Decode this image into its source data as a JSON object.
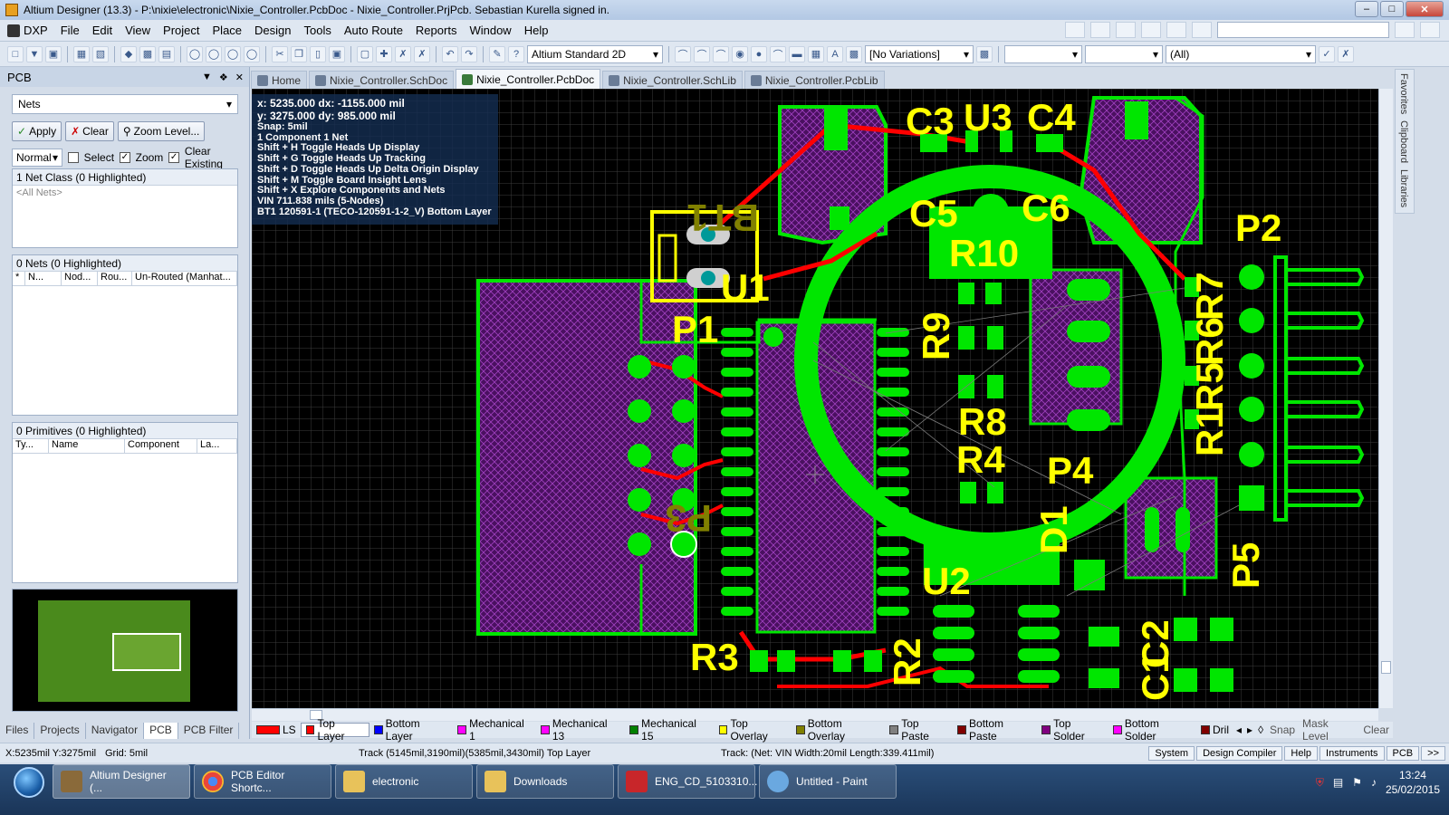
{
  "window": {
    "title": "Altium Designer (13.3) - P:\\nixie\\electronic\\Nixie_Controller.PcbDoc - Nixie_Controller.PrjPcb. Sebastian Kurella signed in."
  },
  "menu": {
    "items": [
      "DXP",
      "File",
      "Edit",
      "View",
      "Project",
      "Place",
      "Design",
      "Tools",
      "Auto Route",
      "Reports",
      "Window",
      "Help"
    ]
  },
  "toolbar": {
    "view_mode": "Altium Standard 2D",
    "variations": "[No Variations]",
    "filter_all": "(All)"
  },
  "panel": {
    "title": "PCB",
    "mode": "Nets",
    "apply": "Apply",
    "clear": "Clear",
    "zoom_level": "Zoom Level...",
    "mask_mode": "Normal",
    "select": "Select",
    "zoom": "Zoom",
    "clear_existing": "Clear Existing",
    "net_class_header": "1 Net Class (0 Highlighted)",
    "all_nets": "<All Nets>",
    "nets_header": "0 Nets (0 Highlighted)",
    "net_cols": [
      "*",
      "N...",
      "Nod...",
      "Rou...",
      "Un-Routed (Manhat..."
    ],
    "primitives_header": "0 Primitives (0 Highlighted)",
    "prim_cols": [
      "Ty...",
      "Name",
      "Component",
      "La..."
    ],
    "tabs": [
      "Files",
      "Projects",
      "Navigator",
      "PCB",
      "PCB Filter"
    ]
  },
  "doc_tabs": [
    "Home",
    "Nixie_Controller.SchDoc",
    "Nixie_Controller.PcbDoc",
    "Nixie_Controller.SchLib",
    "Nixie_Controller.PcbLib"
  ],
  "right_sidebar": [
    "Favorites",
    "Clipboard",
    "Libraries"
  ],
  "hud": {
    "line1": "x:  5235.000   dx: -1155.000  mil",
    "line2": "y:  3275.000   dy:  985.000  mil",
    "lines": [
      "Snap: 5mil",
      "1 Component 1 Net",
      "Shift + H   Toggle Heads Up Display",
      "Shift + G   Toggle Heads Up Tracking",
      "Shift + D   Toggle Heads Up Delta Origin Display",
      "Shift + M   Toggle Board Insight Lens",
      "Shift + X   Explore Components and Nets",
      "VIN    711.838 mils  (5-Nodes)",
      "BT1  120591-1 (TECO-120591-1-2_V)  Bottom Layer"
    ]
  },
  "designators": [
    "C3",
    "U3",
    "C4",
    "C5",
    "C6",
    "R10",
    "BT1",
    "U1",
    "P1",
    "P2",
    "R7",
    "R6",
    "R5",
    "R1",
    "R9",
    "R8",
    "R4",
    "P4",
    "D1",
    "P5",
    "P3",
    "U2",
    "R3",
    "R2",
    "C2",
    "C1"
  ],
  "layers": {
    "ls": "LS",
    "items": [
      {
        "name": "Top Layer",
        "color": "#ff0000"
      },
      {
        "name": "Bottom Layer",
        "color": "#0000ff"
      },
      {
        "name": "Mechanical 1",
        "color": "#ff00ff"
      },
      {
        "name": "Mechanical 13",
        "color": "#ff00ff"
      },
      {
        "name": "Mechanical 15",
        "color": "#008000"
      },
      {
        "name": "Top Overlay",
        "color": "#ffff00"
      },
      {
        "name": "Bottom Overlay",
        "color": "#808000"
      },
      {
        "name": "Top Paste",
        "color": "#808080"
      },
      {
        "name": "Bottom Paste",
        "color": "#800000"
      },
      {
        "name": "Top Solder",
        "color": "#800080"
      },
      {
        "name": "Bottom Solder",
        "color": "#ff00ff"
      },
      {
        "name": "Dril",
        "color": "#800000"
      }
    ],
    "snap": "Snap",
    "mask_level": "Mask Level",
    "clear": "Clear"
  },
  "status": {
    "coords": "X:5235mil Y:3275mil",
    "grid": "Grid: 5mil",
    "track": "Track (5145mil,3190mil)(5385mil,3430mil)  Top Layer",
    "net": "Track: (Net: VIN Width:20mil Length:339.411mil)",
    "buttons": [
      "System",
      "Design Compiler",
      "Help",
      "Instruments",
      "PCB",
      ">>"
    ]
  },
  "taskbar": {
    "items": [
      "Altium Designer (...",
      "PCB Editor Shortc...",
      "electronic",
      "Downloads",
      "ENG_CD_5103310...",
      "Untitled - Paint"
    ],
    "time": "13:24",
    "date": "25/02/2015"
  },
  "colors": {
    "copper": "#00e600",
    "top_layer": "#ff0000",
    "overlay": "#ffff00",
    "solder": "#800080",
    "grid": "#3a3a3a"
  }
}
